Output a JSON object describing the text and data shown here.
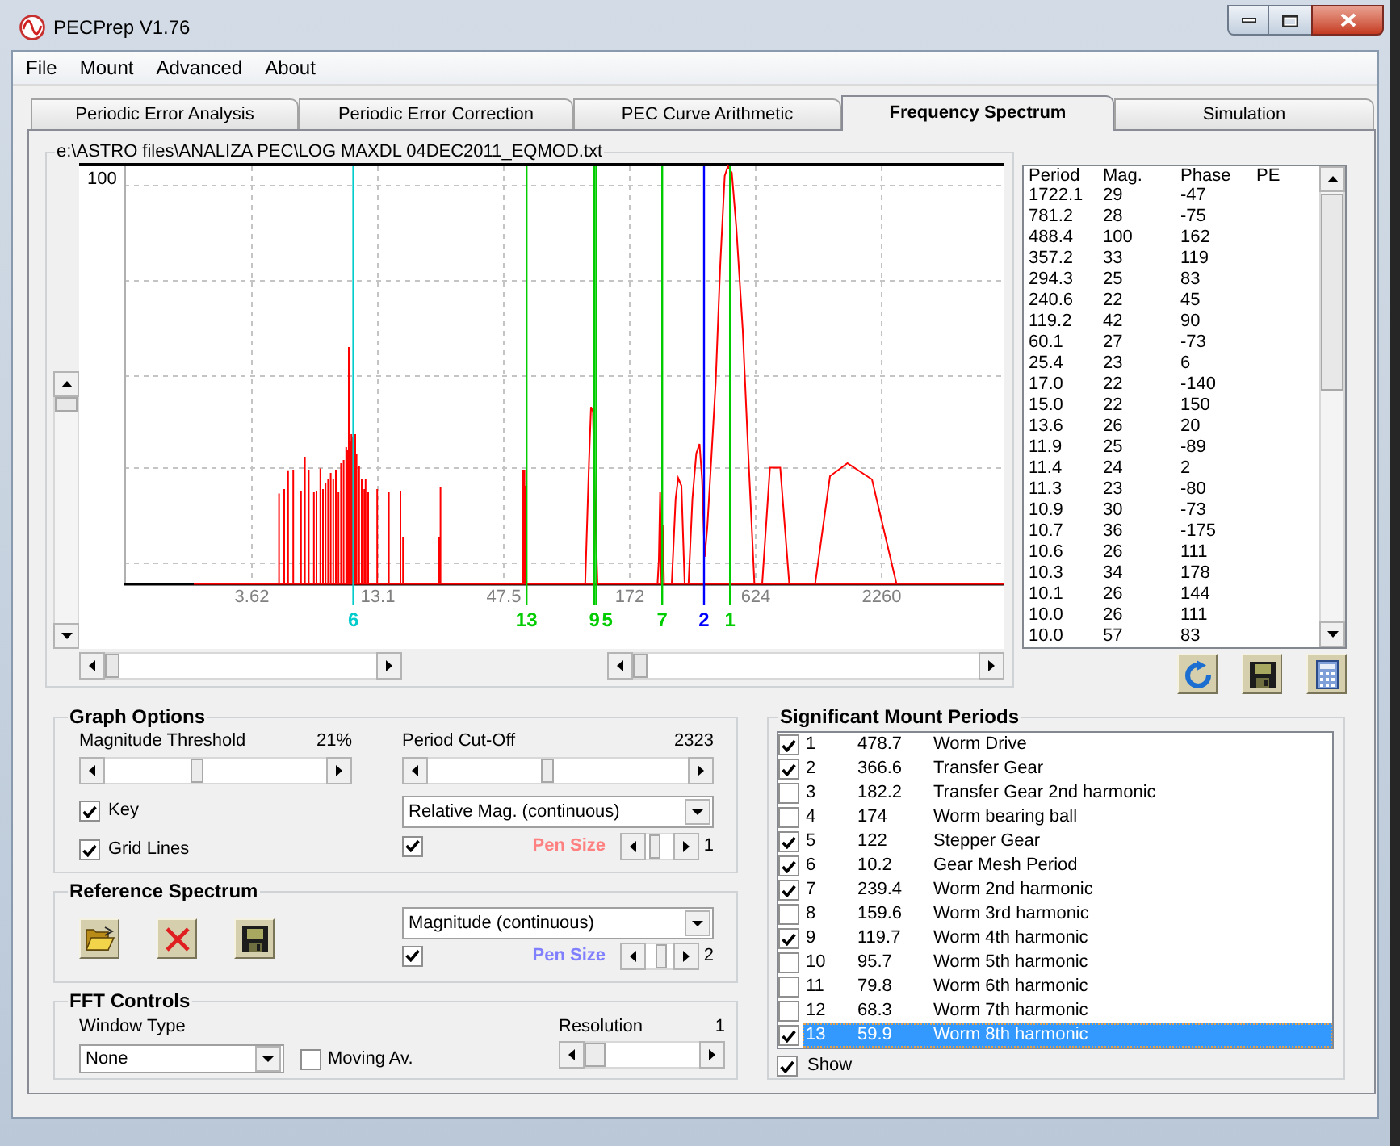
{
  "window": {
    "title": "PECPrep V1.76"
  },
  "menu": [
    "File",
    "Mount",
    "Advanced",
    "About"
  ],
  "tabs": [
    {
      "label": "Periodic Error Analysis",
      "selected": false
    },
    {
      "label": "Periodic Error Correction",
      "selected": false
    },
    {
      "label": "PEC Curve Arithmetic",
      "selected": false
    },
    {
      "label": "Frequency Spectrum",
      "selected": true
    },
    {
      "label": "Simulation",
      "selected": false
    }
  ],
  "spectrum": {
    "file": "e:\\ASTRO files\\ANALIZA PEC\\LOG MAXDL 04DEC2011_EQMOD.txt",
    "y_axis_label": "100",
    "x_axis_labels": [
      "3.62",
      "13.1",
      "47.5",
      "172",
      "624",
      "2260"
    ],
    "markers": [
      {
        "label": "6",
        "color": "#00cccc"
      },
      {
        "label": "13",
        "color": "#00cc00"
      },
      {
        "label": "9",
        "color": "#00cc00"
      },
      {
        "label": "5",
        "color": "#00cc00"
      },
      {
        "label": "7",
        "color": "#00cc00"
      },
      {
        "label": "2",
        "color": "#0000ff"
      },
      {
        "label": "1",
        "color": "#00cc00"
      }
    ]
  },
  "periods_table": {
    "columns": [
      "Period",
      "Mag.",
      "Phase",
      "PE"
    ],
    "rows": [
      [
        "1722.1",
        "29",
        "-47"
      ],
      [
        "781.2",
        "28",
        "-75"
      ],
      [
        "488.4",
        "100",
        "162"
      ],
      [
        "357.2",
        "33",
        "119"
      ],
      [
        "294.3",
        "25",
        "83"
      ],
      [
        "240.6",
        "22",
        "45"
      ],
      [
        "119.2",
        "42",
        "90"
      ],
      [
        "60.1",
        "27",
        "-73"
      ],
      [
        "25.4",
        "23",
        "6"
      ],
      [
        "17.0",
        "22",
        "-140"
      ],
      [
        "15.0",
        "22",
        "150"
      ],
      [
        "13.6",
        "26",
        "20"
      ],
      [
        "11.9",
        "25",
        "-89"
      ],
      [
        "11.4",
        "24",
        "2"
      ],
      [
        "11.3",
        "23",
        "-80"
      ],
      [
        "10.9",
        "30",
        "-73"
      ],
      [
        "10.7",
        "36",
        "-175"
      ],
      [
        "10.6",
        "26",
        "111"
      ],
      [
        "10.3",
        "34",
        "178"
      ],
      [
        "10.1",
        "26",
        "144"
      ],
      [
        "10.0",
        "26",
        "111"
      ],
      [
        "10.0",
        "57",
        "83"
      ]
    ]
  },
  "graph_options": {
    "title": "Graph Options",
    "magnitude_threshold": {
      "label": "Magnitude Threshold",
      "reading": "21%",
      "level": 0.41
    },
    "period_cutoff": {
      "label": "Period Cut-Off",
      "reading": "2323",
      "level": 0.46
    },
    "key": {
      "label": "Key",
      "checked": true
    },
    "grid_lines": {
      "label": "Grid Lines",
      "checked": true
    },
    "display_mode": {
      "value": "Relative Mag. (continuous)"
    },
    "pen": {
      "checked": true,
      "label": "Pen Size",
      "color": "#ff8080",
      "level": 0.2,
      "reading": "1"
    }
  },
  "reference_spectrum": {
    "title": "Reference Spectrum",
    "display_mode": {
      "value": "Magnitude (continuous)"
    },
    "pen": {
      "checked": true,
      "label": "Pen Size",
      "color": "#8080ff",
      "level": 0.55,
      "reading": "2"
    }
  },
  "fft_controls": {
    "title": "FFT Controls",
    "window_type": {
      "label": "Window Type",
      "value": "None"
    },
    "moving_average": {
      "label": "Moving Av.",
      "checked": false
    },
    "resolution": {
      "label": "Resolution",
      "reading": "1",
      "level": 0
    }
  },
  "mount_periods": {
    "title": "Significant Mount Periods",
    "items": [
      {
        "number": "1",
        "period": "478.7",
        "name": "Worm Drive",
        "checked": true,
        "selected": false
      },
      {
        "number": "2",
        "period": "366.6",
        "name": "Transfer Gear",
        "checked": true,
        "selected": false
      },
      {
        "number": "3",
        "period": "182.2",
        "name": "Transfer Gear 2nd harmonic",
        "checked": false,
        "selected": false
      },
      {
        "number": "4",
        "period": "174",
        "name": "Worm bearing ball",
        "checked": false,
        "selected": false
      },
      {
        "number": "5",
        "period": "122",
        "name": "Stepper Gear",
        "checked": true,
        "selected": false
      },
      {
        "number": "6",
        "period": "10.2",
        "name": "Gear Mesh Period",
        "checked": true,
        "selected": false
      },
      {
        "number": "7",
        "period": "239.4",
        "name": "Worm 2nd harmonic",
        "checked": true,
        "selected": false
      },
      {
        "number": "8",
        "period": "159.6",
        "name": "Worm 3rd harmonic",
        "checked": false,
        "selected": false
      },
      {
        "number": "9",
        "period": "119.7",
        "name": "Worm 4th harmonic",
        "checked": true,
        "selected": false
      },
      {
        "number": "10",
        "period": "95.7",
        "name": "Worm 5th harmonic",
        "checked": false,
        "selected": false
      },
      {
        "number": "11",
        "period": "79.8",
        "name": "Worm 6th harmonic",
        "checked": false,
        "selected": false
      },
      {
        "number": "12",
        "period": "68.3",
        "name": "Worm 7th harmonic",
        "checked": false,
        "selected": false
      },
      {
        "number": "13",
        "period": "59.9",
        "name": "Worm 8th harmonic",
        "checked": true,
        "selected": true
      }
    ],
    "show": {
      "label": "Show",
      "checked": true
    }
  }
}
